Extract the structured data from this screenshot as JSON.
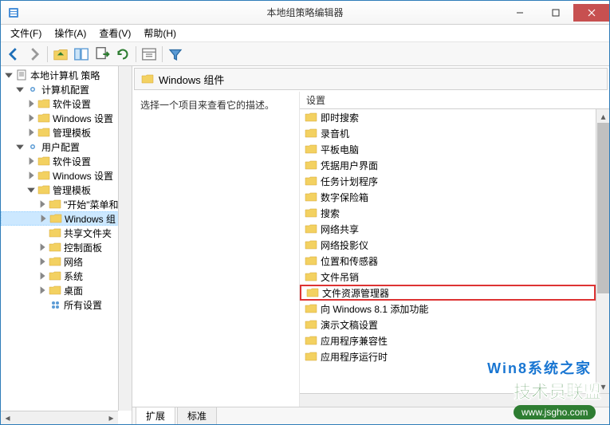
{
  "window": {
    "title": "本地组策略编辑器"
  },
  "menu": {
    "file": "文件(F)",
    "action": "操作(A)",
    "view": "查看(V)",
    "help": "帮助(H)"
  },
  "tree": {
    "root": "本地计算机 策略",
    "computer_config": "计算机配置",
    "cc_software": "软件设置",
    "cc_windows": "Windows 设置",
    "cc_admin": "管理模板",
    "user_config": "用户配置",
    "uc_software": "软件设置",
    "uc_windows": "Windows 设置",
    "uc_admin": "管理模板",
    "ua_start": "\"开始\"菜单和",
    "ua_wincomp": "Windows 组",
    "ua_shared": "共享文件夹",
    "ua_control": "控制面板",
    "ua_network": "网络",
    "ua_system": "系统",
    "ua_desktop": "桌面",
    "ua_all": "所有设置"
  },
  "main": {
    "header": "Windows 组件",
    "description": "选择一个项目来查看它的描述。",
    "column_header": "设置"
  },
  "items": [
    "即时搜索",
    "录音机",
    "平板电脑",
    "凭据用户界面",
    "任务计划程序",
    "数字保险箱",
    "搜索",
    "网络共享",
    "网络投影仪",
    "位置和传感器",
    "文件吊销",
    "文件资源管理器",
    "向 Windows 8.1 添加功能",
    "演示文稿设置",
    "应用程序兼容性",
    "应用程序运行时"
  ],
  "highlighted_index": 11,
  "tabs": {
    "extended": "扩展",
    "standard": "标准"
  },
  "watermark": {
    "title": "技术员联盟",
    "url": "www.jsgho.com",
    "overlay": "Win8系统之家"
  }
}
